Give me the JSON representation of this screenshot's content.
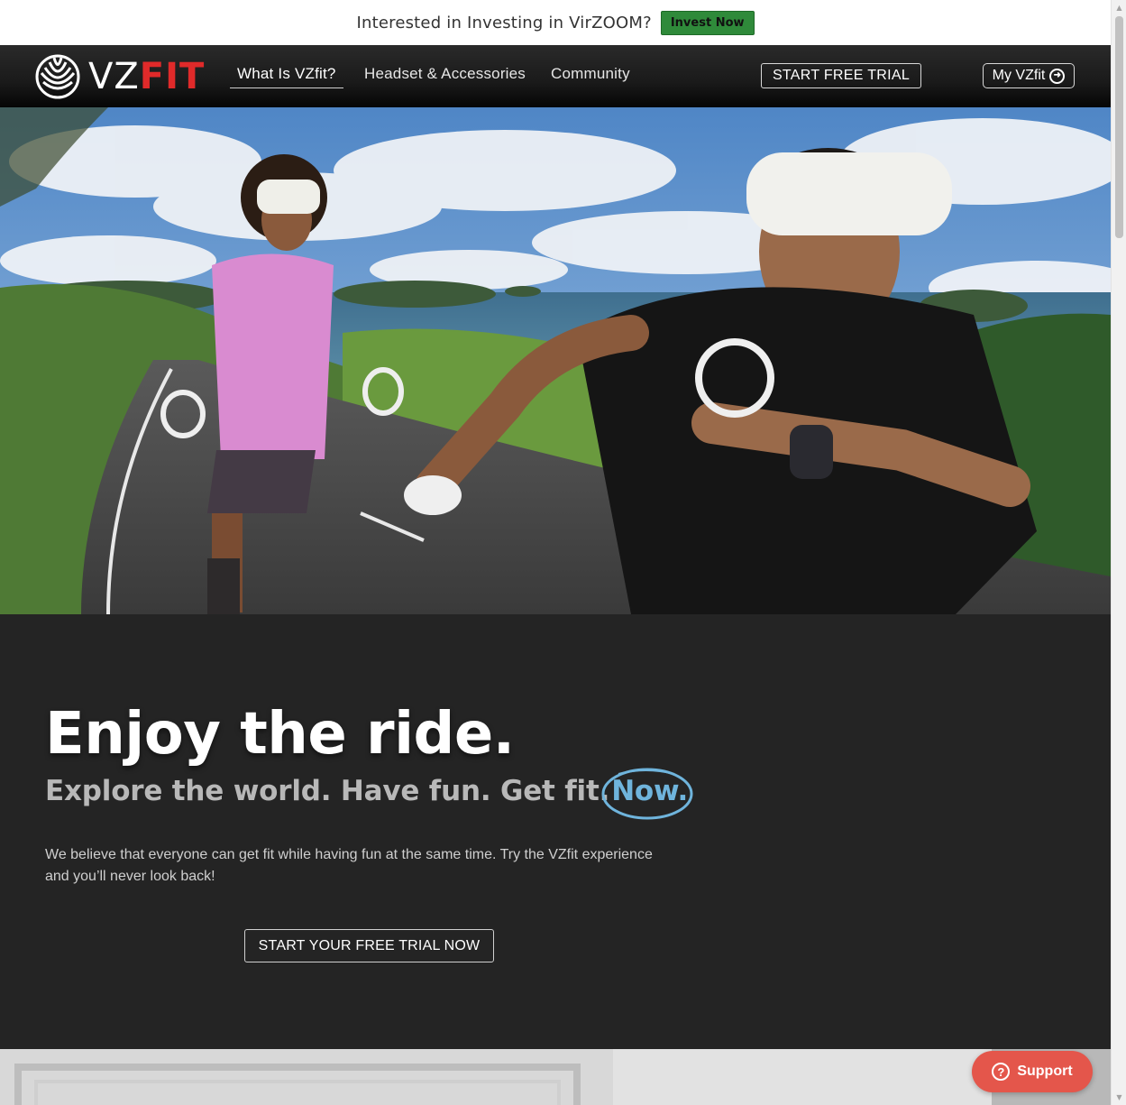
{
  "announcement": {
    "text": "Interested in Investing in VirZOOM?",
    "button_label": "Invest Now"
  },
  "nav": {
    "logo_vz": "VZ",
    "logo_fit": "FIT",
    "links": [
      {
        "label": "What Is VZfit?",
        "active": true
      },
      {
        "label": "Headset & Accessories",
        "active": false
      },
      {
        "label": "Community",
        "active": false
      }
    ],
    "trial_button": "START FREE TRIAL",
    "account_button": "My VZfit"
  },
  "hero": {
    "headline": "Enjoy the ride.",
    "subhead": "Explore the world. Have fun. Get fit.",
    "subhead_highlight": "Now.",
    "body": "We believe that everyone can get fit while having fun at the same time. Try the VZfit experience and you’ll never look back!",
    "cta_label": "START YOUR FREE TRIAL NOW"
  },
  "support": {
    "label": "Support"
  },
  "colors": {
    "brand_red": "#e02a2a",
    "invest_green": "#2f8a3a",
    "now_blue": "#6fb4dc",
    "support_red": "#e4564b",
    "dark_bg": "#242424"
  },
  "icons": {
    "logo": "vzfit-logo-icon",
    "account": "arrow-right-circle-icon",
    "support": "question-circle-icon"
  }
}
